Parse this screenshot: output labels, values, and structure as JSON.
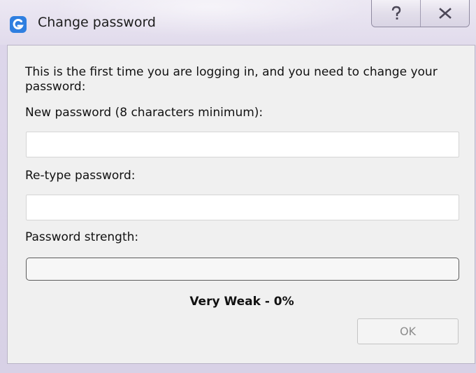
{
  "window": {
    "title": "Change password",
    "help_button_label": "?",
    "close_button_label": "✕",
    "icon": "app-logo-icon",
    "colors": {
      "title_bar": "#e1dbec",
      "app_icon": "#2f7fe0",
      "dialog_background": "#f0f0f0",
      "strength_fill": "#d23a3a"
    }
  },
  "form": {
    "intro_text": "This is the first time you are logging in, and you need to change your password:",
    "new_password": {
      "label": "New password (8 characters minimum):",
      "value": "",
      "placeholder": ""
    },
    "retype_password": {
      "label": "Re-type password:",
      "value": "",
      "placeholder": ""
    },
    "strength": {
      "label": "Password strength:",
      "value_text": "Very Weak - 0%",
      "percent": 0
    },
    "ok_button_label": "OK",
    "ok_button_enabled": false
  }
}
